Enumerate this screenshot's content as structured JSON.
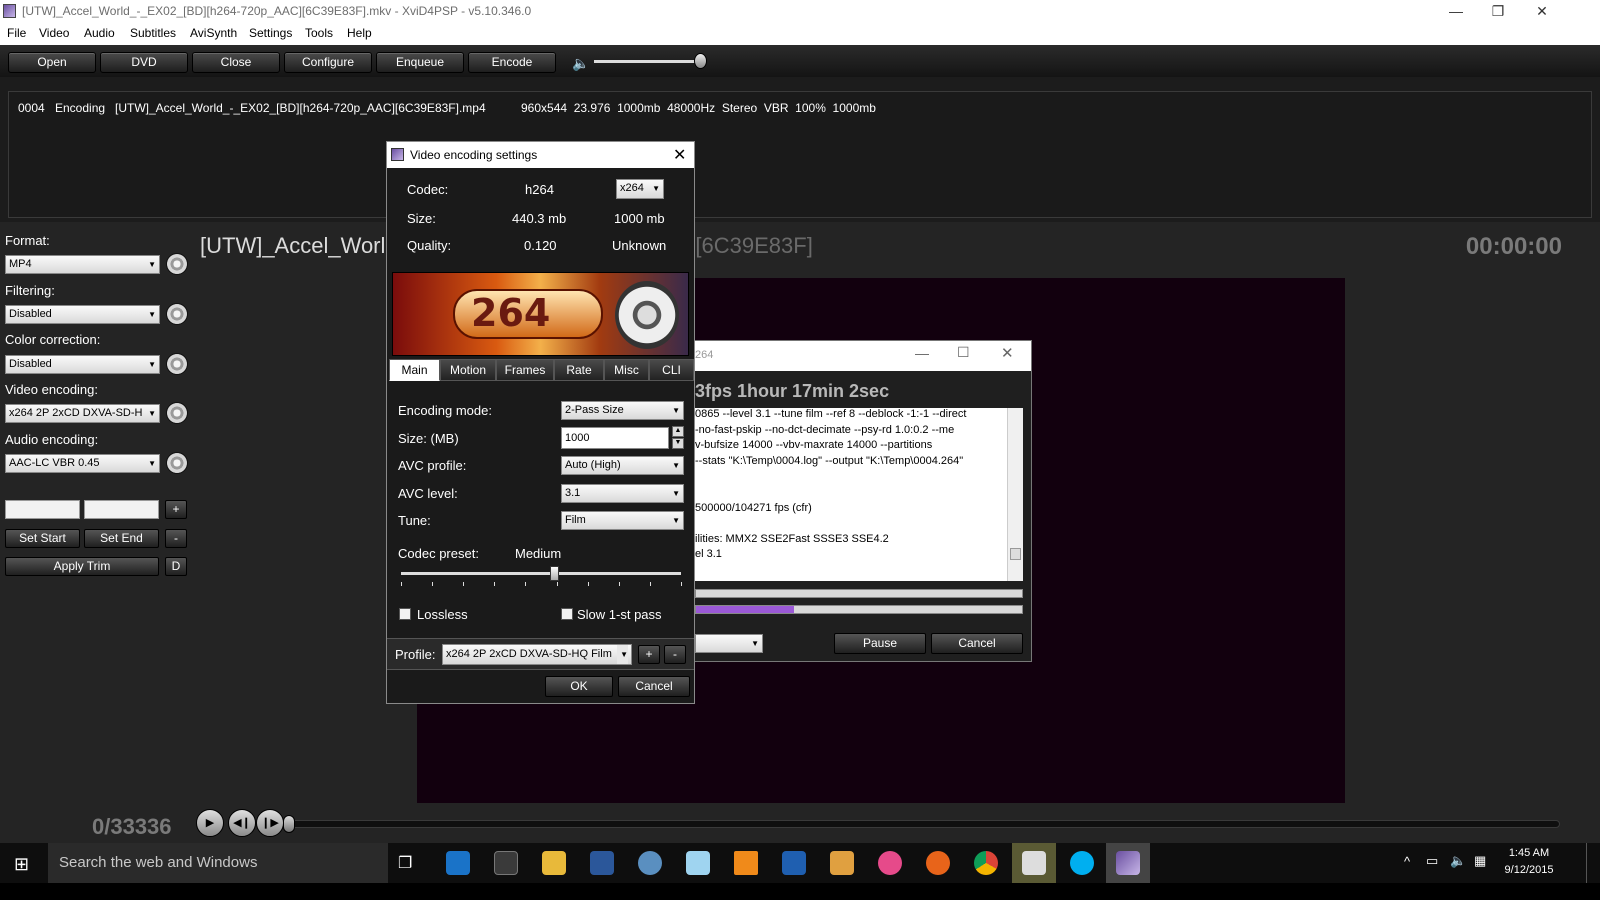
{
  "window": {
    "title": "[UTW]_Accel_World_-_EX02_[BD][h264-720p_AAC][6C39E83F].mkv - XviD4PSP - v5.10.346.0",
    "controls": [
      "—",
      "❐",
      "✕"
    ]
  },
  "menu": [
    "File",
    "Video",
    "Audio",
    "Subtitles",
    "AviSynth",
    "Settings",
    "Tools",
    "Help"
  ],
  "toolbar": {
    "buttons": [
      "Open",
      "DVD",
      "Close",
      "Configure",
      "Enqueue",
      "Encode"
    ],
    "volume_icon": "speaker-icon"
  },
  "queue": {
    "row": {
      "num": "0004",
      "status": "Encoding",
      "file": "[UTW]_Accel_World_-_EX02_[BD][h264-720p_AAC][6C39E83F].mp4",
      "details": "960x544  23.976  1000mb  48000Hz  Stereo  VBR  100%  1000mb"
    }
  },
  "sidebar": {
    "format": {
      "label": "Format:",
      "value": "MP4"
    },
    "filtering": {
      "label": "Filtering:",
      "value": "Disabled"
    },
    "color": {
      "label": "Color correction:",
      "value": "Disabled"
    },
    "video": {
      "label": "Video encoding:",
      "value": "x264 2P 2xCD DXVA-SD-H"
    },
    "audio": {
      "label": "Audio encoding:",
      "value": "AAC-LC VBR 0.45"
    },
    "plus": "+",
    "minus": "-",
    "set_start": "Set Start",
    "set_end": "Set End",
    "apply_trim": "Apply Trim",
    "d": "D"
  },
  "player": {
    "title_left": "[UTW]_Accel_Worl",
    "title_right": "[6C39E83F]",
    "time": "00:00:00",
    "frames": "0/33336"
  },
  "encoder_window": {
    "title": "264",
    "status": "3fps 1hour 17min 2sec",
    "log": [
      "0865 --level 3.1 --tune film --ref 8 --deblock -1:-1 --direct",
      "-no-fast-pskip --no-dct-decimate --psy-rd 1.0:0.2 --me",
      "v-bufsize 14000 --vbv-maxrate 14000 --partitions",
      " --stats \"K:\\Temp\\0004.log\" --output \"K:\\Temp\\0004.264\"",
      "",
      "",
      "500000/104271 fps (cfr)",
      "",
      "ilities: MMX2 SSE2Fast SSSE3 SSE4.2",
      "el 3.1"
    ],
    "progress1": 0.0,
    "progress2": 0.3,
    "pause": "Pause",
    "cancel": "Cancel"
  },
  "dialog": {
    "title": "Video encoding settings",
    "codec_label": "Codec:",
    "codec_value": "h264",
    "codec_select": "x264",
    "size_label": "Size:",
    "size_value": "440.3 mb",
    "size_target": "1000 mb",
    "quality_label": "Quality:",
    "quality_value": "0.120",
    "quality_target": "Unknown",
    "banner_text": "264",
    "tabs": [
      "Main",
      "Motion",
      "Frames",
      "Rate",
      "Misc",
      "CLI"
    ],
    "encoding_mode_label": "Encoding mode:",
    "encoding_mode": "2-Pass Size",
    "size_mb_label": "Size: (MB)",
    "size_mb": "1000",
    "avc_profile_label": "AVC profile:",
    "avc_profile": "Auto (High)",
    "avc_level_label": "AVC level:",
    "avc_level": "3.1",
    "tune_label": "Tune:",
    "tune": "Film",
    "preset_label": "Codec preset:",
    "preset_value": "Medium",
    "preset_level": 0.55,
    "lossless": "Lossless",
    "slow_first": "Slow 1-st pass",
    "profile_label": "Profile:",
    "profile_value": "x264 2P 2xCD DXVA-SD-HQ Film",
    "plus": "+",
    "minus": "-",
    "ok": "OK",
    "cancel": "Cancel"
  },
  "taskbar": {
    "search": "Search the web and Windows",
    "time": "1:45 AM",
    "date": "9/12/2015"
  }
}
